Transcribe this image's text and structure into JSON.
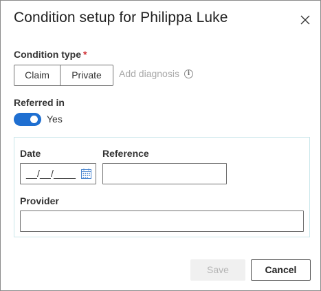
{
  "dialog": {
    "title": "Condition setup for Philippa Luke"
  },
  "condition_type": {
    "label": "Condition type",
    "required_marker": "*",
    "options": [
      "Claim",
      "Private"
    ],
    "add_diagnosis_label": "Add diagnosis",
    "info_glyph": "i"
  },
  "referred_in": {
    "label": "Referred in",
    "toggle_on": true,
    "toggle_text": "Yes"
  },
  "referral": {
    "date_label": "Date",
    "date_value": "__/__/____",
    "reference_label": "Reference",
    "reference_value": "",
    "provider_label": "Provider",
    "provider_value": ""
  },
  "footer": {
    "save_label": "Save",
    "save_disabled": true,
    "cancel_label": "Cancel"
  },
  "colors": {
    "accent": "#1f6fd1",
    "required": "#d13438",
    "panel_border": "#c9e6ea",
    "muted_text": "#a8a8a8"
  },
  "icons": {
    "close": "close-icon",
    "info": "info-icon",
    "calendar": "calendar-icon"
  }
}
